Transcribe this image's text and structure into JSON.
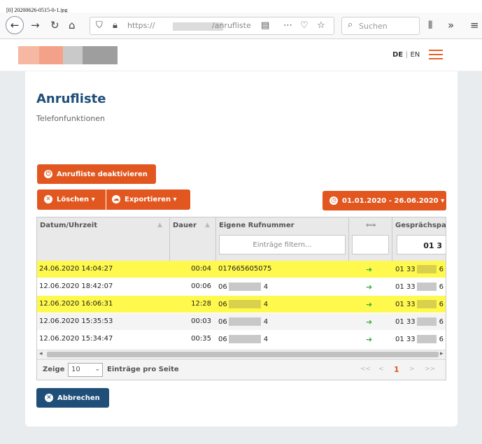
{
  "screenshot_label": "[0] 20200626-0515-0-1.jpg",
  "browser": {
    "url_protocol": "https://",
    "url_path": "/anrufliste",
    "search_placeholder": "Suchen"
  },
  "header": {
    "lang_de": "DE",
    "lang_sep": "|",
    "lang_en": "EN"
  },
  "page": {
    "title": "Anrufliste",
    "subtitle": "Telefonfunktionen",
    "deactivate_label": "Anrufliste deaktivieren",
    "delete_label": "Löschen ▾",
    "export_label": "Exportieren ▾",
    "date_range_label": "01.01.2020 - 26.06.2020 ▾",
    "cancel_label": "Abbrechen"
  },
  "table": {
    "columns": [
      "Datum/Uhrzeit",
      "Dauer",
      "Eigene Rufnummer",
      "⟺",
      "Gesprächspa"
    ],
    "filter_placeholder": "Einträge filtern...",
    "partner_filter_value": "01 3",
    "rows": [
      {
        "date": "24.06.2020 14:04:27",
        "duration": "00:04",
        "own_prefix": "017665605075",
        "own_suffix": "",
        "direction": "➜",
        "partner_prefix": "01 33",
        "partner_suffix": "6",
        "highlight": "yellow"
      },
      {
        "date": "12.06.2020 18:42:07",
        "duration": "00:06",
        "own_prefix": "06",
        "own_suffix": "4",
        "direction": "➜",
        "partner_prefix": "01 33",
        "partner_suffix": "6",
        "highlight": "white"
      },
      {
        "date": "12.06.2020 16:06:31",
        "duration": "12:28",
        "own_prefix": "06",
        "own_suffix": "4",
        "direction": "➜",
        "partner_prefix": "01 33",
        "partner_suffix": "6",
        "highlight": "yellow"
      },
      {
        "date": "12.06.2020 15:35:53",
        "duration": "00:03",
        "own_prefix": "06",
        "own_suffix": "4",
        "direction": "➜",
        "partner_prefix": "01 33",
        "partner_suffix": "6",
        "highlight": "alt"
      },
      {
        "date": "12.06.2020 15:34:47",
        "duration": "00:35",
        "own_prefix": "06",
        "own_suffix": "4",
        "direction": "➜",
        "partner_prefix": "01 33",
        "partner_suffix": "6",
        "highlight": "white"
      }
    ]
  },
  "footer": {
    "show_label": "Zeige",
    "page_size": "10",
    "per_page_label": "Einträge pro Seite",
    "pager_first": "<<",
    "pager_prev": "<",
    "current_page": "1",
    "pager_next": ">",
    "pager_last": ">>"
  },
  "colors": {
    "accent": "#e2571f",
    "primary": "#1f4e79",
    "highlight": "#fff94d",
    "arrow": "#3cb043"
  }
}
